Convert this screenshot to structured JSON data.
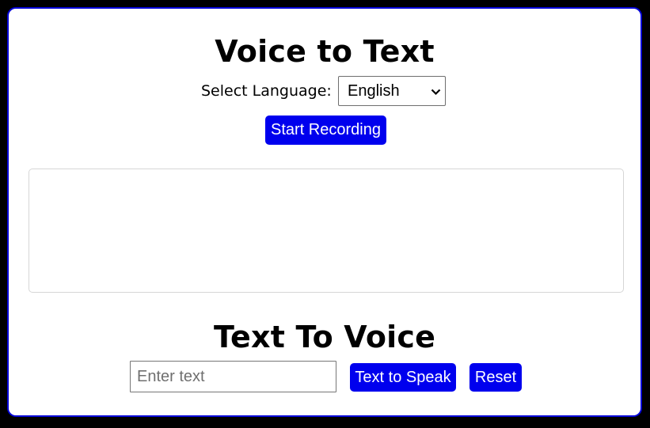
{
  "voice_to_text": {
    "title": "Voice to Text",
    "language_label": "Select Language:",
    "language_selected": "English",
    "record_button": "Start Recording",
    "transcript": ""
  },
  "text_to_voice": {
    "title": "Text To Voice",
    "input_placeholder": "Enter text",
    "input_value": "",
    "speak_button": "Text to Speak",
    "reset_button": "Reset"
  },
  "colors": {
    "page_background": "#000000",
    "card_border": "#0000d8",
    "button_background": "#0000ee",
    "button_text": "#ffffff"
  },
  "icons": {
    "select_arrow": "chevron-down-icon"
  }
}
